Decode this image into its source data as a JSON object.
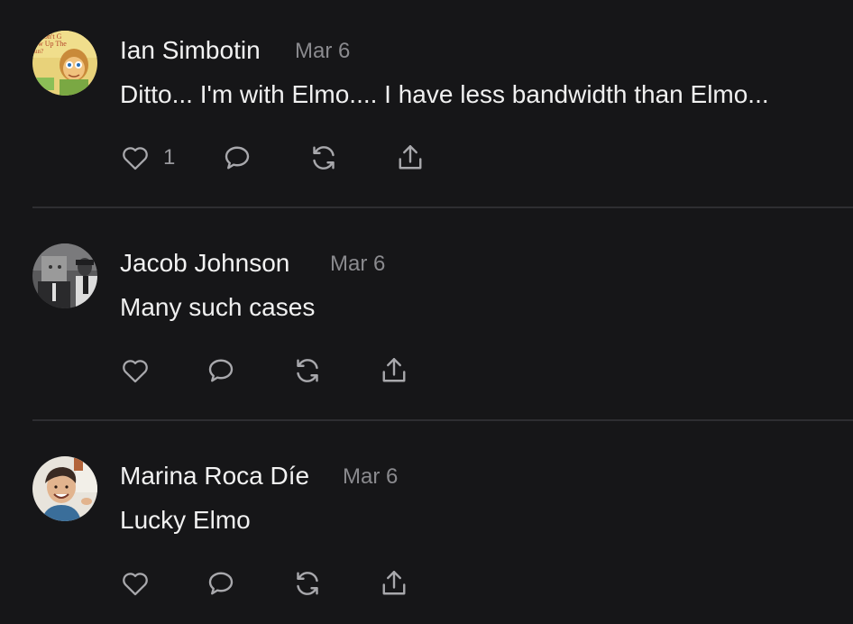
{
  "comments": [
    {
      "author": "Ian Simbotin",
      "date": "Mar 6",
      "text": "Ditto... I'm with Elmo.... I have less bandwidth than Elmo...",
      "likes": "1",
      "avatar_text": [
        "Won't G",
        "ow Up The",
        "un?"
      ],
      "avatar_icon": "cartoon-book-cover-avatar"
    },
    {
      "author": "Jacob Johnson",
      "date": "Mar 6",
      "text": "Many such cases",
      "likes": "",
      "avatar_icon": "grayscale-photo-avatar"
    },
    {
      "author": "Marina Roca Díe",
      "date": "Mar 6",
      "text": "Lucky Elmo",
      "likes": "",
      "avatar_icon": "smiling-person-avatar"
    }
  ],
  "icons": {
    "like": "heart-icon",
    "reply": "speech-bubble-icon",
    "restack": "refresh-arrows-icon",
    "share": "share-upload-icon"
  },
  "colors": {
    "background": "#161618",
    "text": "#f0f0f0",
    "muted": "#8a8a8e",
    "icon": "#a8a8ac",
    "divider": "#2e2e31"
  }
}
